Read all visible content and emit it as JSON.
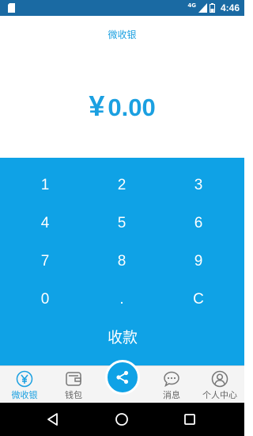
{
  "status_bar": {
    "network": "4G",
    "time": "4:46"
  },
  "header": {
    "title": "微收银"
  },
  "amount": {
    "currency_symbol": "¥",
    "value": "0.00"
  },
  "keypad": {
    "keys": [
      "1",
      "2",
      "3",
      "4",
      "5",
      "6",
      "7",
      "8",
      "9",
      "0",
      ".",
      "C"
    ],
    "submit_label": "收款"
  },
  "tabs": [
    {
      "label": "微收银",
      "icon": "yen-circle-icon",
      "active": true
    },
    {
      "label": "钱包",
      "icon": "wallet-icon",
      "active": false
    },
    {
      "label": "",
      "icon": "share-icon",
      "active": false
    },
    {
      "label": "消息",
      "icon": "chat-bubble-icon",
      "active": false
    },
    {
      "label": "个人中心",
      "icon": "user-icon",
      "active": false
    }
  ],
  "colors": {
    "accent": "#0fa2e6",
    "status_bar": "#1a6aa3",
    "tab_bar": "#f4f4f4"
  }
}
